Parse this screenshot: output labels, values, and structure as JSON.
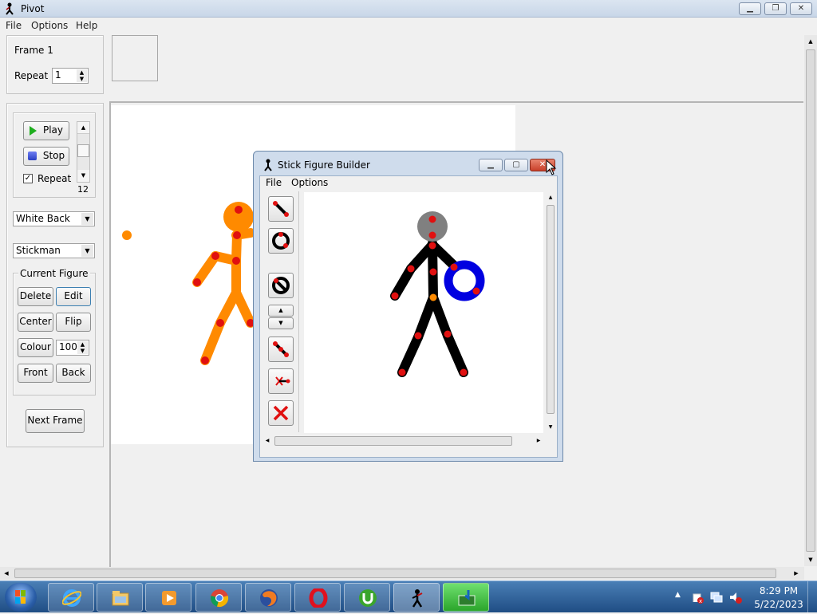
{
  "window": {
    "title": "Pivot"
  },
  "menu": [
    "File",
    "Options",
    "Help"
  ],
  "frame_panel": {
    "frame_label": "Frame 1",
    "repeat_label": "Repeat :",
    "repeat_value": "1"
  },
  "playback": {
    "play_label": "Play",
    "stop_label": "Stop",
    "repeat_label": "Repeat",
    "repeat_checked": true,
    "speed_value": "12"
  },
  "background_select": "White Back",
  "figure_type_select": "Stickman",
  "current_figure": {
    "legend": "Current Figure",
    "delete_label": "Delete",
    "edit_label": "Edit",
    "center_label": "Center",
    "flip_label": "Flip",
    "colour_label": "Colour",
    "colour_value": "100",
    "front_label": "Front",
    "back_label": "Back"
  },
  "next_frame_label": "Next Frame",
  "builder": {
    "title": "Stick Figure Builder",
    "menu": [
      "File",
      "Options"
    ],
    "tools": [
      "line-segment-icon",
      "circle-segment-icon",
      "filled-circle-icon",
      "up-down-icon",
      "duplicate-segment-icon",
      "delete-joint-icon",
      "delete-figure-icon"
    ]
  },
  "taskbar": {
    "apps": [
      "internet-explorer-icon",
      "file-explorer-icon",
      "media-player-icon",
      "chrome-icon",
      "firefox-icon",
      "opera-icon",
      "utorrent-icon",
      "pivot-icon",
      "download-manager-icon"
    ],
    "clock_time": "8:29 PM",
    "clock_date": "5/22/2023"
  },
  "colors": {
    "figure_main": "#ff8a00",
    "joint": "#e01010",
    "builder_figure": "#000000",
    "builder_ring": "#0000e0",
    "builder_head": "#808080"
  }
}
